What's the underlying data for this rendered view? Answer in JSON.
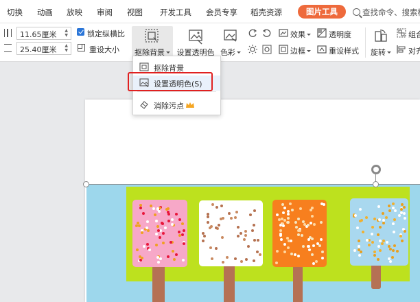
{
  "tabs": [
    {
      "label": "切换"
    },
    {
      "label": "动画"
    },
    {
      "label": "放映"
    },
    {
      "label": "审阅"
    },
    {
      "label": "视图"
    },
    {
      "label": "开发工具"
    },
    {
      "label": "会员专享"
    },
    {
      "label": "稻壳资源"
    },
    {
      "label": "图片工具",
      "active": true
    }
  ],
  "search": {
    "placeholder": "查找命令、搜索模"
  },
  "ribbon": {
    "width_value": "11.65厘米",
    "height_value": "25.40厘米",
    "lock_ratio_label": "锁定纵横比",
    "lock_ratio_checked": true,
    "reset_size_label": "重设大小",
    "remove_bg_label": "抠除背景",
    "set_transparent_label": "设置透明色",
    "color_label": "色彩",
    "effects_label": "效果",
    "transparency_label": "透明度",
    "border_label": "边框",
    "reset_style_label": "重设样式",
    "rotate_label": "旋转",
    "combine_label": "组合",
    "align_label": "对齐"
  },
  "dropdown": {
    "items": [
      {
        "label": "抠除背景",
        "icon": "remove-background-icon"
      },
      {
        "label": "设置透明色(S)",
        "icon": "set-transparent-icon",
        "highlighted": true
      },
      {
        "label": "消除污点",
        "icon": "eraser-icon",
        "badge": "crown-icon"
      }
    ]
  },
  "colors": {
    "accent_tab": "#ee6a3c",
    "highlight_box": "#e02020",
    "picture_sky": "#9dd7ec",
    "picture_green": "#bde11e",
    "popsicle_pink": "#f7a8c8",
    "popsicle_white": "#ffffff",
    "popsicle_orange": "#f77f1e",
    "popsicle_blue": "#a9d8ef",
    "stick": "#b57154"
  }
}
